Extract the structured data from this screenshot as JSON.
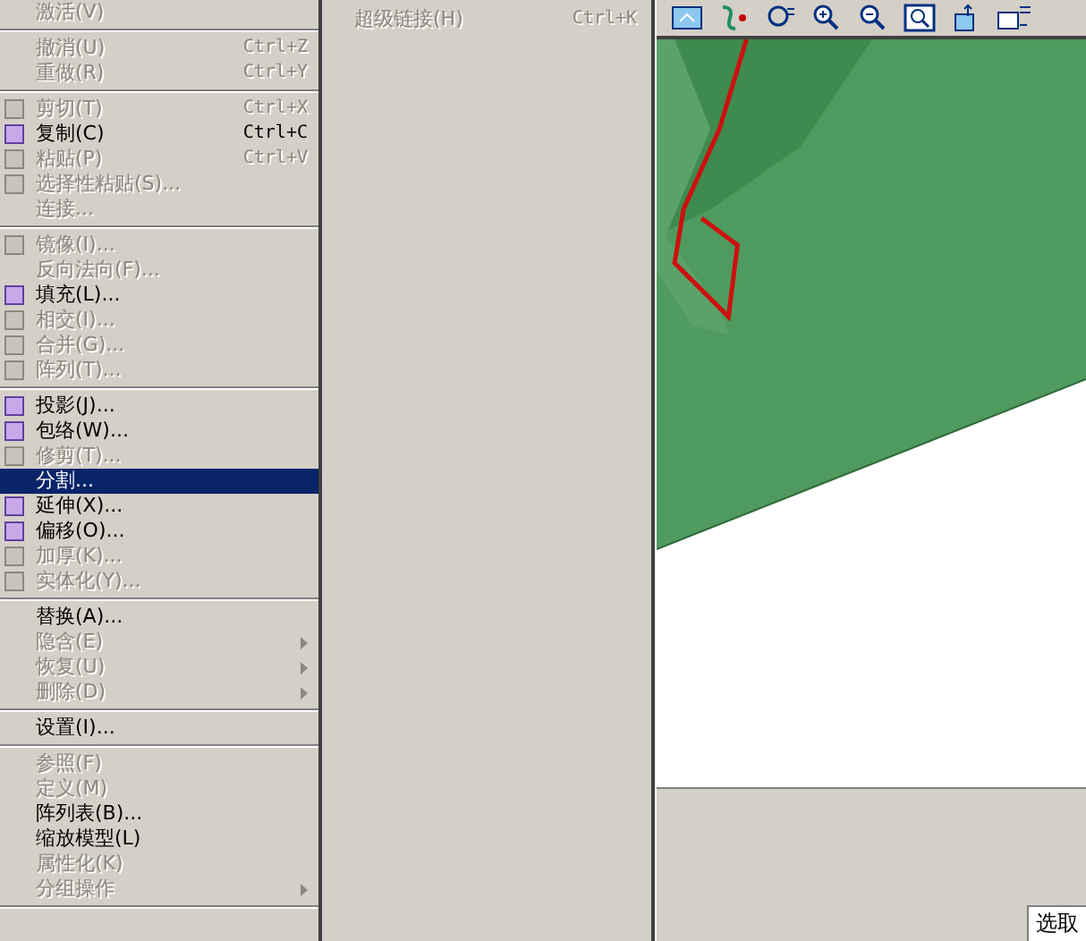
{
  "menu": {
    "items": [
      {
        "kind": "item",
        "label": "激活(V)",
        "disabled": true,
        "icon": false,
        "submenu": false,
        "selected": false
      },
      {
        "kind": "separator"
      },
      {
        "kind": "item",
        "label": "撤消(U)",
        "shortcut": "Ctrl+Z",
        "disabled": true,
        "icon": false,
        "submenu": false,
        "selected": false
      },
      {
        "kind": "item",
        "label": "重做(R)",
        "shortcut": "Ctrl+Y",
        "disabled": true,
        "icon": false,
        "submenu": false,
        "selected": false
      },
      {
        "kind": "separator"
      },
      {
        "kind": "item",
        "label": "剪切(T)",
        "shortcut": "Ctrl+X",
        "disabled": true,
        "icon": true,
        "submenu": false,
        "selected": false
      },
      {
        "kind": "item",
        "label": "复制(C)",
        "shortcut": "Ctrl+C",
        "disabled": false,
        "icon": true,
        "submenu": false,
        "selected": false
      },
      {
        "kind": "item",
        "label": "粘贴(P)",
        "shortcut": "Ctrl+V",
        "disabled": true,
        "icon": true,
        "submenu": false,
        "selected": false
      },
      {
        "kind": "item",
        "label": "选择性粘贴(S)...",
        "disabled": true,
        "icon": true,
        "submenu": false,
        "selected": false
      },
      {
        "kind": "item",
        "label": "连接...",
        "disabled": true,
        "icon": false,
        "submenu": false,
        "selected": false
      },
      {
        "kind": "separator"
      },
      {
        "kind": "item",
        "label": "镜像(I)...",
        "disabled": true,
        "icon": true,
        "submenu": false,
        "selected": false
      },
      {
        "kind": "item",
        "label": "反向法向(F)...",
        "disabled": true,
        "icon": false,
        "submenu": false,
        "selected": false
      },
      {
        "kind": "item",
        "label": "填充(L)...",
        "disabled": false,
        "icon": true,
        "submenu": false,
        "selected": false
      },
      {
        "kind": "item",
        "label": "相交(I)...",
        "disabled": true,
        "icon": true,
        "submenu": false,
        "selected": false
      },
      {
        "kind": "item",
        "label": "合并(G)...",
        "disabled": true,
        "icon": true,
        "submenu": false,
        "selected": false
      },
      {
        "kind": "item",
        "label": "阵列(T)...",
        "disabled": true,
        "icon": true,
        "submenu": false,
        "selected": false
      },
      {
        "kind": "separator"
      },
      {
        "kind": "item",
        "label": "投影(J)...",
        "disabled": false,
        "icon": true,
        "submenu": false,
        "selected": false
      },
      {
        "kind": "item",
        "label": "包络(W)...",
        "disabled": false,
        "icon": true,
        "submenu": false,
        "selected": false
      },
      {
        "kind": "item",
        "label": "修剪(T)...",
        "disabled": true,
        "icon": true,
        "submenu": false,
        "selected": false
      },
      {
        "kind": "item",
        "label": "分割...",
        "disabled": false,
        "icon": false,
        "submenu": false,
        "selected": true
      },
      {
        "kind": "item",
        "label": "延伸(X)...",
        "disabled": false,
        "icon": true,
        "submenu": false,
        "selected": false
      },
      {
        "kind": "item",
        "label": "偏移(O)...",
        "disabled": false,
        "icon": true,
        "submenu": false,
        "selected": false
      },
      {
        "kind": "item",
        "label": "加厚(K)...",
        "disabled": true,
        "icon": true,
        "submenu": false,
        "selected": false
      },
      {
        "kind": "item",
        "label": "实体化(Y)...",
        "disabled": true,
        "icon": true,
        "submenu": false,
        "selected": false
      },
      {
        "kind": "separator"
      },
      {
        "kind": "item",
        "label": "替换(A)...",
        "disabled": false,
        "icon": false,
        "submenu": false,
        "selected": false
      },
      {
        "kind": "item",
        "label": "隐含(E)",
        "disabled": true,
        "icon": false,
        "submenu": true,
        "selected": false
      },
      {
        "kind": "item",
        "label": "恢复(U)",
        "disabled": true,
        "icon": false,
        "submenu": true,
        "selected": false
      },
      {
        "kind": "item",
        "label": "删除(D)",
        "disabled": true,
        "icon": false,
        "submenu": true,
        "selected": false
      },
      {
        "kind": "separator"
      },
      {
        "kind": "item",
        "label": "设置(I)...",
        "disabled": false,
        "icon": false,
        "submenu": false,
        "selected": false
      },
      {
        "kind": "separator"
      },
      {
        "kind": "item",
        "label": "参照(F)",
        "disabled": true,
        "icon": false,
        "submenu": false,
        "selected": false
      },
      {
        "kind": "item",
        "label": "定义(M)",
        "disabled": true,
        "icon": false,
        "submenu": false,
        "selected": false
      },
      {
        "kind": "item",
        "label": "阵列表(B)...",
        "disabled": false,
        "icon": false,
        "submenu": false,
        "selected": false
      },
      {
        "kind": "item",
        "label": "缩放模型(L)",
        "disabled": false,
        "icon": false,
        "submenu": false,
        "selected": false
      },
      {
        "kind": "item",
        "label": "属性化(K)",
        "disabled": true,
        "icon": false,
        "submenu": false,
        "selected": false
      },
      {
        "kind": "item",
        "label": "分组操作",
        "disabled": true,
        "icon": false,
        "submenu": true,
        "selected": false
      },
      {
        "kind": "separator"
      }
    ]
  },
  "side_menu": {
    "items": [
      {
        "label": "超级链接(H)",
        "shortcut": "Ctrl+K",
        "disabled": true
      }
    ]
  },
  "status_bar": {
    "text": "选取"
  }
}
